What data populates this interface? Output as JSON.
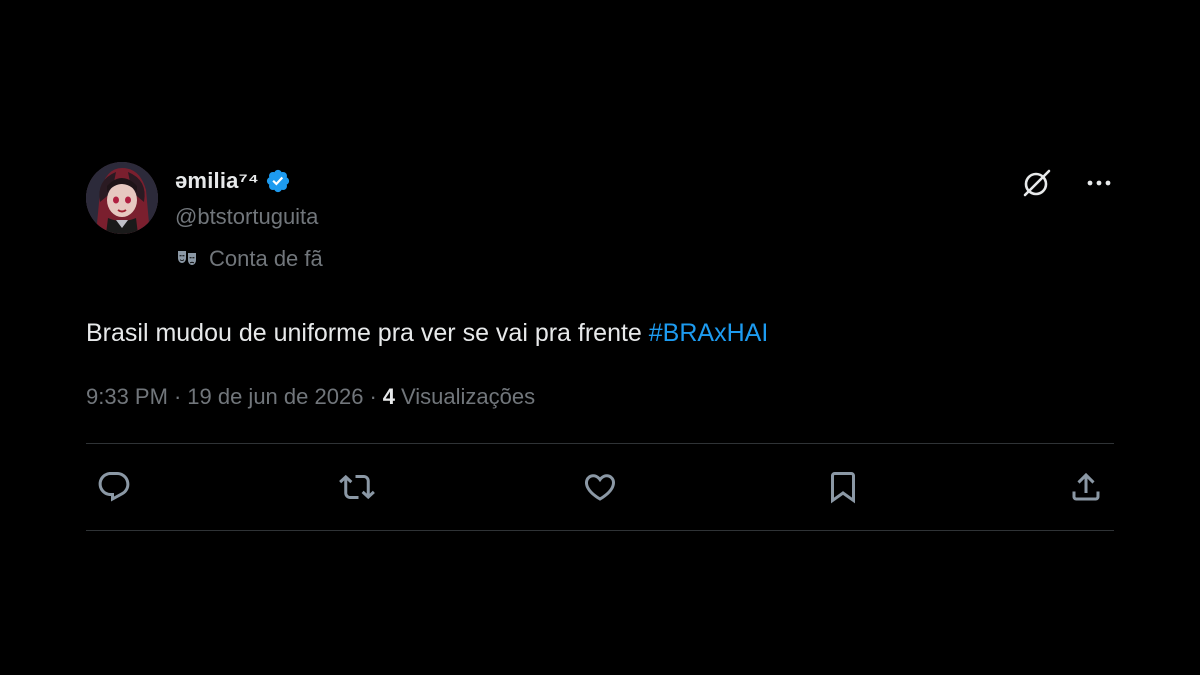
{
  "user": {
    "display_name": "əmilia⁷⁴",
    "handle": "@btstortuguita",
    "affiliation_label": "Conta de fã",
    "verified": true
  },
  "tweet": {
    "text": "Brasil mudou de uniforme pra ver se vai pra frente",
    "hashtag": "#BRAxHAI",
    "time": "9:33 PM",
    "separator": "·",
    "date": "19 de jun de 2026",
    "views_count": "4",
    "views_label": "Visualizações"
  },
  "icons": {
    "verified": "verified-badge-icon",
    "affiliation": "theater-mask-icon",
    "grok": "grok-icon",
    "more": "more-icon",
    "reply": "reply-icon",
    "retweet": "retweet-icon",
    "like": "heart-icon",
    "bookmark": "bookmark-icon",
    "share": "share-icon"
  },
  "colors": {
    "background": "#000000",
    "text_primary": "#e7e9ea",
    "text_secondary": "#71767b",
    "accent": "#1d9bf0",
    "divider": "#2f3336"
  }
}
